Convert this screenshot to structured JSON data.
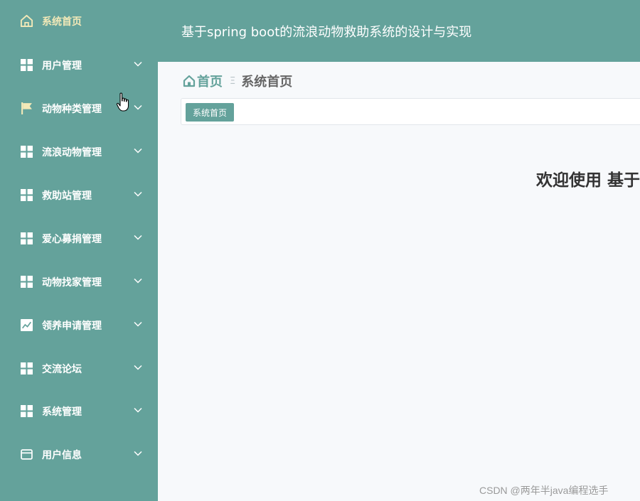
{
  "header": {
    "title": "基于spring boot的流浪动物救助系统的设计与实现"
  },
  "sidebar": {
    "items": [
      {
        "label": "系统首页",
        "icon": "home-icon"
      },
      {
        "label": "用户管理",
        "icon": "grid-icon"
      },
      {
        "label": "动物种类管理",
        "icon": "flag-icon"
      },
      {
        "label": "流浪动物管理",
        "icon": "grid-icon"
      },
      {
        "label": "救助站管理",
        "icon": "grid-icon"
      },
      {
        "label": "爱心募捐管理",
        "icon": "grid-icon"
      },
      {
        "label": "动物找家管理",
        "icon": "grid-icon"
      },
      {
        "label": "领养申请管理",
        "icon": "chart-icon"
      },
      {
        "label": "交流论坛",
        "icon": "grid-icon"
      },
      {
        "label": "系统管理",
        "icon": "grid-icon"
      },
      {
        "label": "用户信息",
        "icon": "wallet-icon"
      }
    ]
  },
  "breadcrumb": {
    "home": "首页",
    "separator": "Ξ",
    "current": "系统首页"
  },
  "tabs": [
    {
      "label": "系统首页",
      "active": true
    }
  ],
  "main": {
    "welcome": "欢迎使用 基于"
  },
  "watermark": "CSDN @两年半java编程选手",
  "colors": {
    "primary": "#64a29b",
    "home_label": "#f3e9b8",
    "background": "#f7f9fb"
  }
}
